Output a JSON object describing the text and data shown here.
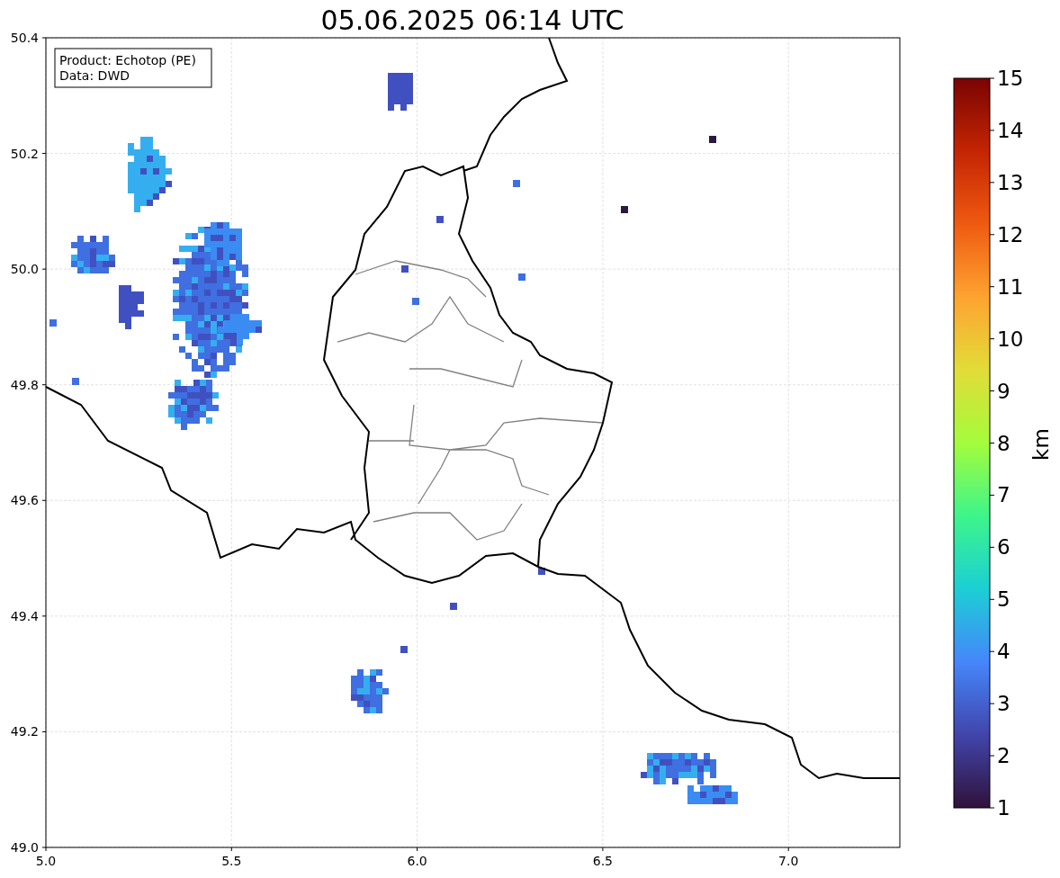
{
  "title": "05.06.2025 06:14 UTC",
  "legend": [
    "Product: Echotop (PE)",
    "Data: DWD"
  ],
  "map": {
    "xticks": [
      "5.0",
      "5.5",
      "6.0",
      "6.5",
      "7.0"
    ],
    "yticks": [
      "50.4",
      "50.2",
      "50.0",
      "49.8",
      "49.6",
      "49.4",
      "49.2",
      "49.0"
    ]
  },
  "colorbar": {
    "label": "km",
    "ticks": [
      "15",
      "14",
      "13",
      "12",
      "11",
      "10",
      "9",
      "8",
      "7",
      "6",
      "5",
      "4",
      "3",
      "2",
      "1"
    ]
  }
}
